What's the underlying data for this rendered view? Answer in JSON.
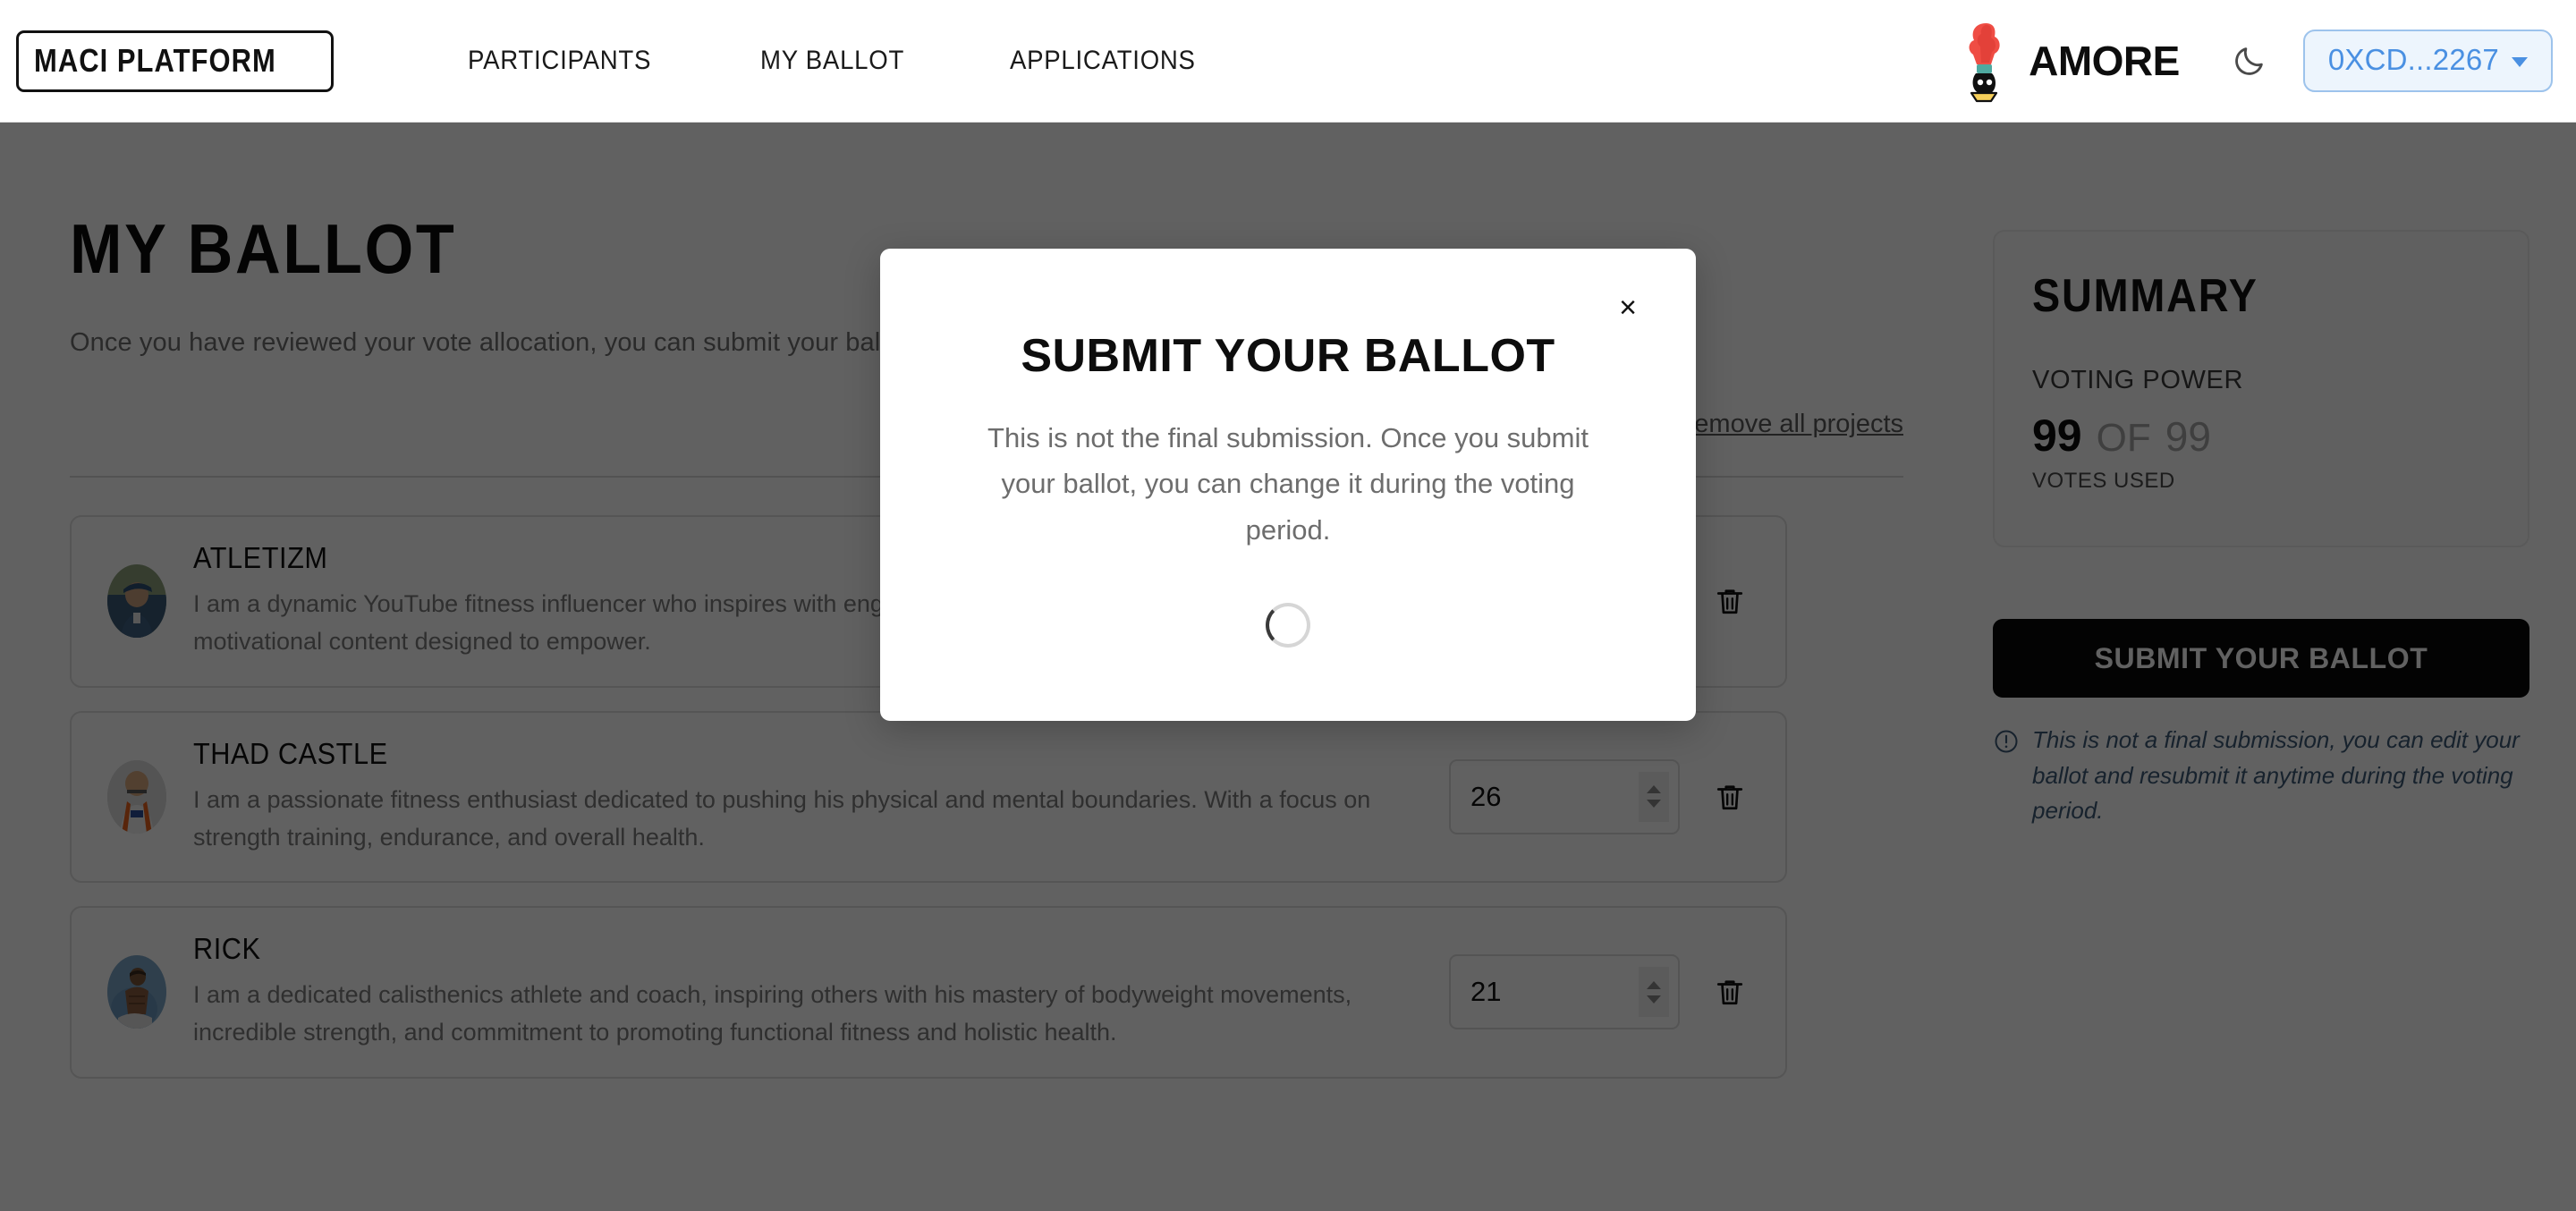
{
  "header": {
    "logo_text": "MACI PLATFORM",
    "nav": [
      {
        "label": "PARTICIPANTS"
      },
      {
        "label": "MY BALLOT"
      },
      {
        "label": "APPLICATIONS"
      }
    ],
    "brand_name": "AMORE",
    "theme_toggle_icon": "moon-icon",
    "wallet_label": "0XCD...2267"
  },
  "main": {
    "title": "MY BALLOT",
    "subtitle": "Once you have reviewed your vote allocation, you can submit your ballot.",
    "remove_all_label": "Remove all projects",
    "items": [
      {
        "name": "ATLETIZM",
        "description": "I am a dynamic YouTube fitness influencer who inspires with engaging workouts, practical health tips, and motivational content designed to empower.",
        "votes": "",
        "avatar_alt": "person-in-blue-cap"
      },
      {
        "name": "THAD CASTLE",
        "description": "I am a passionate fitness enthusiast dedicated to pushing his physical and mental boundaries. With a focus on strength training, endurance, and overall health.",
        "votes": "26",
        "avatar_alt": "football-player"
      },
      {
        "name": "RICK",
        "description": "I am a dedicated calisthenics athlete and coach, inspiring others with his mastery of bodyweight movements, incredible strength, and commitment to promoting functional fitness and holistic health.",
        "votes": "21",
        "avatar_alt": "calisthenics-athlete"
      }
    ]
  },
  "summary": {
    "title": "SUMMARY",
    "voting_power_label": "VOTING POWER",
    "votes_used": "99",
    "of_label": "OF",
    "votes_total": "99",
    "votes_caption": "VOTES USED",
    "submit_label": "SUBMIT YOUR BALLOT",
    "note": "This is not a final submission, you can edit your ballot and resubmit it anytime during the voting period."
  },
  "modal": {
    "title": "SUBMIT YOUR BALLOT",
    "body": "This is not the final submission. Once you submit your ballot, you can change it during the voting period.",
    "close_label": "×",
    "loading": true
  },
  "colors": {
    "accent_blue": "#4a90e2",
    "wallet_bg": "#edf5fd",
    "note_blue": "#3d5a77",
    "submit_black": "#0a0a0a",
    "overlay": "rgba(0,0,0,0.62)"
  }
}
